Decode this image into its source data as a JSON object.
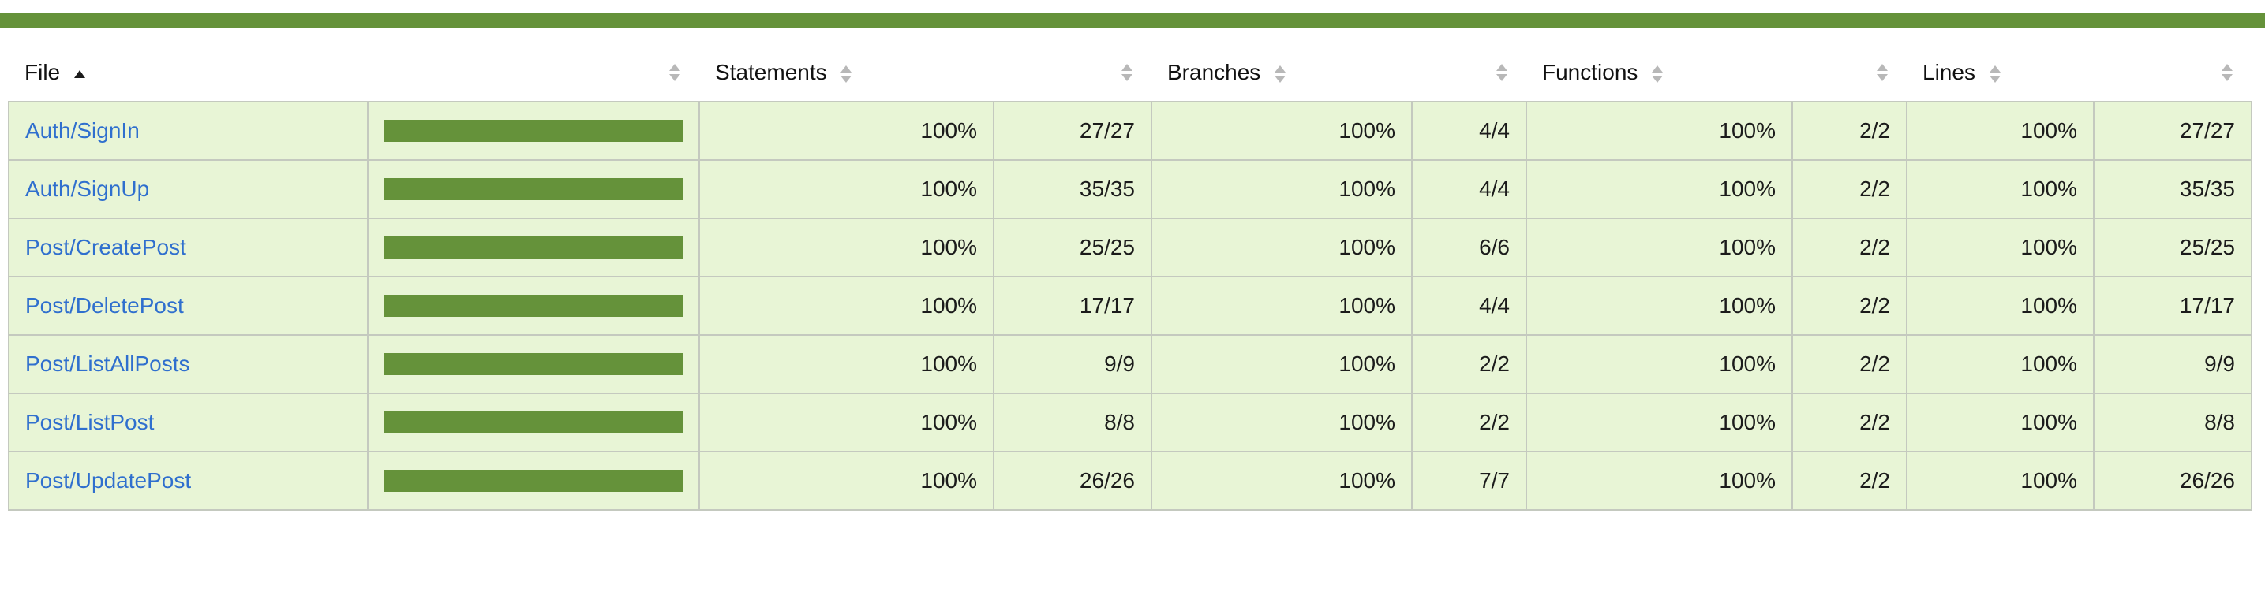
{
  "colors": {
    "accent_bar": "#65923a",
    "row_background": "#e8f5d6",
    "link": "#2f6fce"
  },
  "header": {
    "file": "File",
    "statements": "Statements",
    "branches": "Branches",
    "functions": "Functions",
    "lines": "Lines",
    "sorted_column": "File",
    "sort_direction": "ascending"
  },
  "rows": [
    {
      "file": "Auth/SignIn",
      "coverage_fraction": 1.0,
      "statements_pct": "100%",
      "statements_count": "27/27",
      "branches_pct": "100%",
      "branches_count": "4/4",
      "functions_pct": "100%",
      "functions_count": "2/2",
      "lines_pct": "100%",
      "lines_count": "27/27"
    },
    {
      "file": "Auth/SignUp",
      "coverage_fraction": 1.0,
      "statements_pct": "100%",
      "statements_count": "35/35",
      "branches_pct": "100%",
      "branches_count": "4/4",
      "functions_pct": "100%",
      "functions_count": "2/2",
      "lines_pct": "100%",
      "lines_count": "35/35"
    },
    {
      "file": "Post/CreatePost",
      "coverage_fraction": 1.0,
      "statements_pct": "100%",
      "statements_count": "25/25",
      "branches_pct": "100%",
      "branches_count": "6/6",
      "functions_pct": "100%",
      "functions_count": "2/2",
      "lines_pct": "100%",
      "lines_count": "25/25"
    },
    {
      "file": "Post/DeletePost",
      "coverage_fraction": 1.0,
      "statements_pct": "100%",
      "statements_count": "17/17",
      "branches_pct": "100%",
      "branches_count": "4/4",
      "functions_pct": "100%",
      "functions_count": "2/2",
      "lines_pct": "100%",
      "lines_count": "17/17"
    },
    {
      "file": "Post/ListAllPosts",
      "coverage_fraction": 1.0,
      "statements_pct": "100%",
      "statements_count": "9/9",
      "branches_pct": "100%",
      "branches_count": "2/2",
      "functions_pct": "100%",
      "functions_count": "2/2",
      "lines_pct": "100%",
      "lines_count": "9/9"
    },
    {
      "file": "Post/ListPost",
      "coverage_fraction": 1.0,
      "statements_pct": "100%",
      "statements_count": "8/8",
      "branches_pct": "100%",
      "branches_count": "2/2",
      "functions_pct": "100%",
      "functions_count": "2/2",
      "lines_pct": "100%",
      "lines_count": "8/8"
    },
    {
      "file": "Post/UpdatePost",
      "coverage_fraction": 1.0,
      "statements_pct": "100%",
      "statements_count": "26/26",
      "branches_pct": "100%",
      "branches_count": "7/7",
      "functions_pct": "100%",
      "functions_count": "2/2",
      "lines_pct": "100%",
      "lines_count": "26/26"
    }
  ]
}
